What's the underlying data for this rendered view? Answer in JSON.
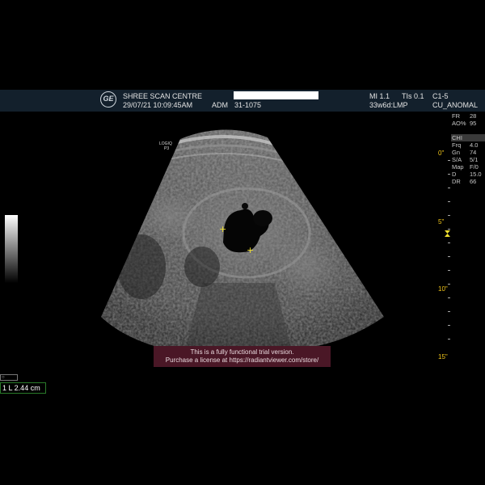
{
  "header": {
    "clinic": "SHREE SCAN CENTRE",
    "datetime": "29/07/21 10:09:45AM",
    "adm": "ADM",
    "patient_id": "31-1075",
    "mi": "MI 1.1",
    "tis": "TIs 0.1",
    "probe": "C1-5",
    "gest_age": "33w6d:LMP",
    "preset": "CU_ANOMAL",
    "logo": "GE"
  },
  "side_params": [
    {
      "k": "FR",
      "v": "28"
    },
    {
      "k": "AO%",
      "v": "95"
    }
  ],
  "chi_label": "CHI",
  "chi_params": [
    {
      "k": "Frq",
      "v": "4.0"
    },
    {
      "k": "Gn",
      "v": "74"
    },
    {
      "k": "S/A",
      "v": "5/1"
    },
    {
      "k": "Map",
      "v": "F/0"
    },
    {
      "k": "D",
      "v": "15.0"
    },
    {
      "k": "DR",
      "v": "66"
    }
  ],
  "depth_markers": {
    "d0": "0\"",
    "d5": "5\"",
    "d10": "10\"",
    "d15": "15\""
  },
  "probe_label": {
    "line1": "LOGIQ",
    "line2": "P3"
  },
  "trial_notice": {
    "line1": "This is a fully functional trial version.",
    "line2": "Purchase a license at https://radiantviewer.com/store/"
  },
  "measurement": {
    "tiny": "○️",
    "label": "1 L 2.44 cm"
  },
  "colors": {
    "header_bg": "#13202c",
    "caliper": "#f0e030",
    "trial_bg": "#4a1726",
    "depth": "#f0c419"
  }
}
